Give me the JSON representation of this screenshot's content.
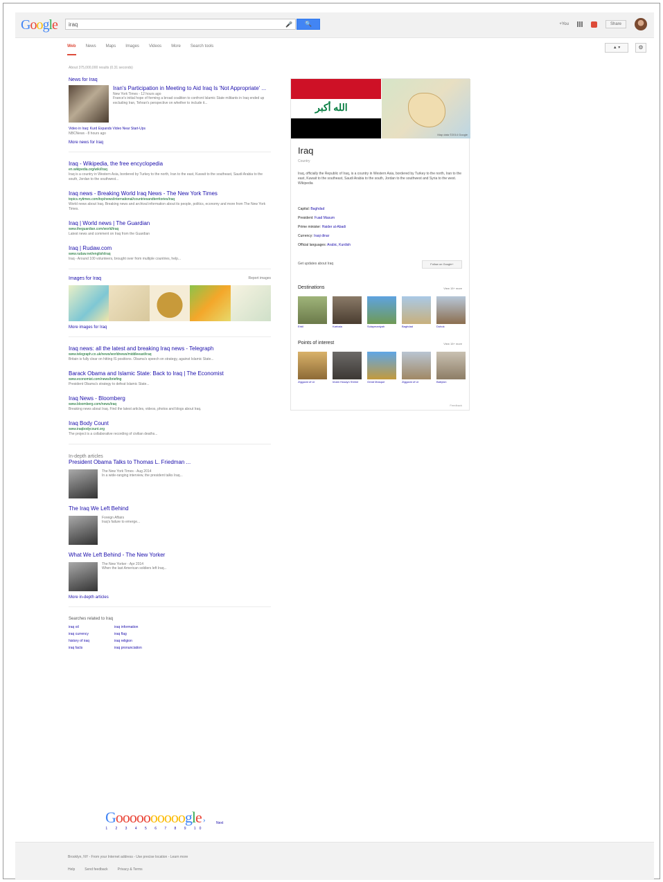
{
  "header": {
    "logo": "Google",
    "query": "iraq",
    "search_button": "🔍",
    "user_name": "+You",
    "share": "Share"
  },
  "tabs": [
    "Web",
    "News",
    "Maps",
    "Images",
    "Videos",
    "More",
    "Search tools"
  ],
  "stats": "About 375,000,000 results (0.31 seconds)",
  "news": {
    "title": "News for Iraq",
    "main_title": "Iran's Participation in Meeting to Aid Iraq Is 'Not Appropriate' ...",
    "main_src": "New York Times - 12 hours ago",
    "main_snip": "France's initial hope of forming a broad coalition to confront Islamic State militants in Iraq ended up excluding Iran, Tehran's perspective on whether to include it...",
    "sub_link": "Video in Iraq: Kurd Expands Video Near Start-Ups",
    "sub_src": "NBCNews - 8 hours ago",
    "more": "More news for Iraq"
  },
  "results": [
    {
      "title": "Iraq - Wikipedia, the free encyclopedia",
      "url": "en.wikipedia.org/wiki/Iraq",
      "snip": "Iraq is a country in Western Asia, bordered by Turkey to the north, Iran to the east, Kuwait to the southeast, Saudi Arabia to the south, Jordan to the southwest..."
    },
    {
      "title": "Iraq news - Breaking World Iraq News - The New York Times",
      "url": "topics.nytimes.com/top/news/international/countriesandterritories/iraq",
      "snip": "World news about Iraq. Breaking news and archival information about its people, politics, economy and more from The New York Times."
    },
    {
      "title": "Iraq | World news | The Guardian",
      "url": "www.theguardian.com/world/iraq",
      "snip": "Latest news and comment on Iraq from the Guardian"
    },
    {
      "title": "Iraq | Rudaw.com",
      "url": "www.rudaw.net/english/iraq",
      "snip": "Iraq - Around 100 volunteers, brought over from multiple countries, help..."
    }
  ],
  "images": {
    "title": "Images for Iraq",
    "report": "Report images",
    "more": "More images for Iraq"
  },
  "results2": [
    {
      "title": "Iraq news: all the latest and breaking Iraq news - Telegraph",
      "url": "www.telegraph.co.uk/news/worldnews/middleeast/iraq",
      "snip": "Britain is fully clear on hitting IS positions. Obama's speech on strategy, against Islamic State..."
    },
    {
      "title": "Barack Obama and Islamic State: Back to Iraq | The Economist",
      "url": "www.economist.com/news/briefing",
      "snip": "President Obama's strategy to defeat Islamic State..."
    },
    {
      "title": "Iraq News - Bloomberg",
      "url": "www.bloomberg.com/news/iraq",
      "snip": "Breaking news about Iraq. Find the latest articles, videos, photos and blogs about Iraq."
    },
    {
      "title": "Iraq Body Count",
      "url": "www.iraqbodycount.org",
      "snip": "The project is a collaborative recording of civilian deaths..."
    }
  ],
  "in_depth": {
    "title": "In-depth articles",
    "articles": [
      {
        "title": "President Obama Talks to Thomas L. Friedman ...",
        "src": "The New York Times - Aug 2014",
        "snip": "In a wide-ranging interview, the president talks Iraq..."
      },
      {
        "title": "The Iraq We Left Behind",
        "src": "Foreign Affairs",
        "snip": "Iraq's failure to emerge..."
      },
      {
        "title": "What We Left Behind - The New Yorker",
        "src": "The New Yorker - Apr 2014",
        "snip": "When the last American soldiers left Iraq..."
      }
    ],
    "more": "More in-depth articles"
  },
  "related": {
    "title": "Searches related to Iraq",
    "items": [
      "iraq oil",
      "iraq information",
      "iraq currency",
      "iraq flag",
      "history of iraq",
      "iraq religion",
      "iraq facts",
      "iraq pronunciation"
    ]
  },
  "pager": {
    "logo": "Goooooooooogle",
    "nums": "1 2 3 4 5 6 7 8 9 10",
    "next": "Next"
  },
  "footer": {
    "line1": "Brooklyn, NY - From your Internet address - Use precise location - Learn more",
    "links": [
      "Help",
      "Send feedback",
      "Privacy & Terms"
    ]
  },
  "knowledge": {
    "title": "Iraq",
    "subtitle": "Country",
    "map_caption": "Map data ©2014 Google",
    "description": "Iraq, officially the Republic of Iraq, is a country in Western Asia, bordered by Turkey to the north, Iran to the east, Kuwait to the southeast, Saudi Arabia to the south, Jordan to the southwest and Syria to the west. Wikipedia",
    "facts": [
      {
        "label": "Capital:",
        "value": "Baghdad"
      },
      {
        "label": "President:",
        "value": "Fuad Masum"
      },
      {
        "label": "Prime minister:",
        "value": "Haider al-Abadi"
      },
      {
        "label": "Currency:",
        "value": "Iraqi dinar"
      },
      {
        "label": "Official languages:",
        "value": "Arabic, Kurdish"
      }
    ],
    "people_text": "Get updates about Iraq",
    "people_btn": "Follow on Google+",
    "dest_title": "Destinations",
    "dest_view": "View 15+ more",
    "destinations": [
      "Erbil",
      "Karbala",
      "Sulaymaniyah",
      "Baghdad",
      "Duhok"
    ],
    "poi_title": "Points of interest",
    "poi_view": "View 15+ more",
    "pois": [
      "Ziggurat of Ur",
      "Imam Husayn Shrine",
      "Great Mosque",
      "Ziggurat of Ur",
      "Babylon"
    ],
    "feedback": "Feedback"
  }
}
